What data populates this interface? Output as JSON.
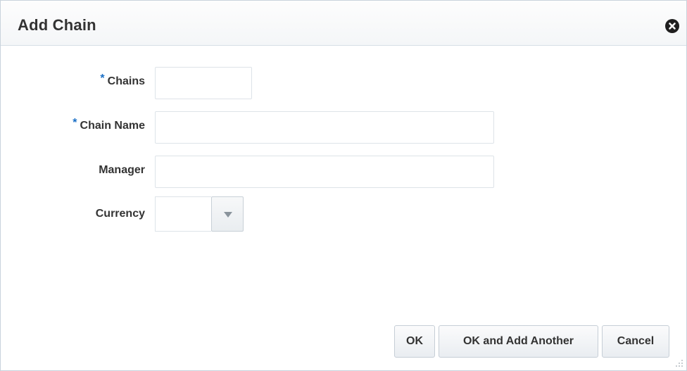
{
  "dialog": {
    "title": "Add Chain",
    "close_icon": "close-circle-icon"
  },
  "form": {
    "required_marker": "*",
    "chains": {
      "label": "Chains",
      "value": "",
      "required": true
    },
    "chain_name": {
      "label": "Chain Name",
      "value": "",
      "required": true
    },
    "manager": {
      "label": "Manager",
      "value": ""
    },
    "currency": {
      "label": "Currency",
      "value": "",
      "dropdown_icon": "chevron-down-icon"
    }
  },
  "buttons": {
    "ok": "OK",
    "ok_add_another": "OK and Add Another",
    "cancel": "Cancel"
  },
  "colors": {
    "required": "#1a6fc6",
    "text": "#333333",
    "border": "#dde3e8"
  }
}
